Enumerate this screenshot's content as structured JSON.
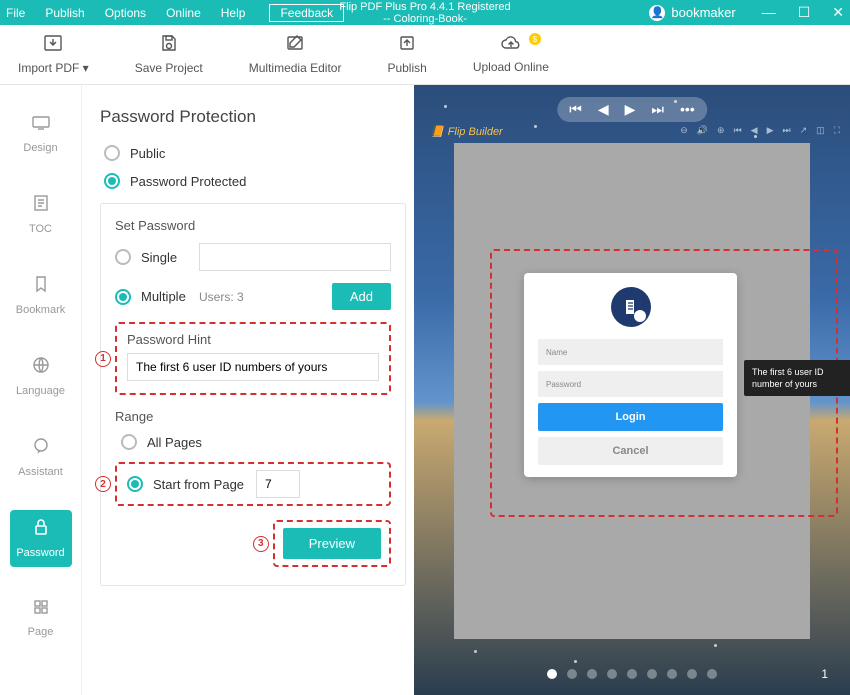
{
  "titlebar": {
    "menus": {
      "file": "File",
      "publish": "Publish",
      "options": "Options",
      "online": "Online",
      "help": "Help"
    },
    "feedback": "Feedback",
    "app_title_line1": "Flip PDF Plus Pro 4.4.1 Registered",
    "app_title_line2": "-- Coloring-Book-",
    "username": "bookmaker"
  },
  "toolbar": {
    "import": "Import PDF ▾",
    "save": "Save Project",
    "mm": "Multimedia Editor",
    "publish": "Publish",
    "upload": "Upload Online"
  },
  "sidenav": {
    "design": "Design",
    "toc": "TOC",
    "bookmark": "Bookmark",
    "language": "Language",
    "assistant": "Assistant",
    "password": "Password",
    "page": "Page"
  },
  "panel": {
    "heading": "Password Protection",
    "opt_public": "Public",
    "opt_protected": "Password Protected",
    "set_password": "Set Password",
    "single": "Single",
    "multiple": "Multiple",
    "users_count": "Users: 3",
    "add": "Add",
    "hint_label": "Password Hint",
    "hint_value": "The first 6 user ID numbers of yours",
    "range_label": "Range",
    "all_pages": "All Pages",
    "start_from": "Start from Page",
    "start_page_value": "7",
    "preview": "Preview",
    "annot1": "1",
    "annot2": "2",
    "annot3": "3"
  },
  "preview": {
    "brand": "Flip Builder",
    "login_name_ph": "Name",
    "login_pwd_ph": "Password",
    "login_btn": "Login",
    "cancel_btn": "Cancel",
    "tooltip": "The first 6 user ID number of yours",
    "page_number": "1"
  }
}
